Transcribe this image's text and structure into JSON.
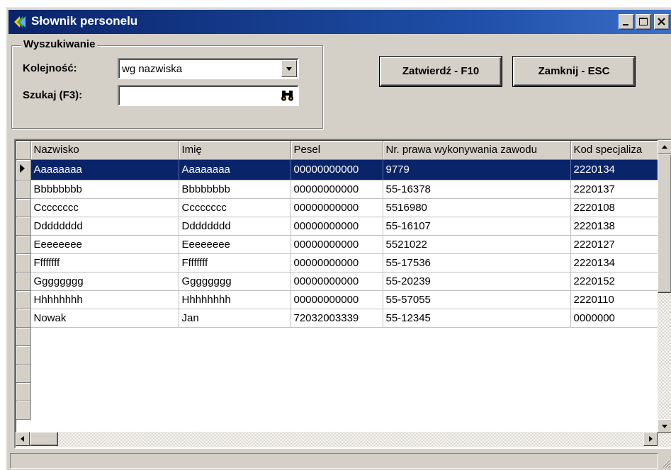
{
  "window": {
    "title": "Słownik personelu"
  },
  "search_group": {
    "legend": "Wyszukiwanie",
    "order_label": "Kolejność:",
    "order_value": "wg nazwiska",
    "search_label": "Szukaj (F3):",
    "search_value": ""
  },
  "buttons": {
    "confirm": "Zatwierdź - F10",
    "close": "Zamknij - ESC"
  },
  "grid": {
    "columns": [
      "Nazwisko",
      "Imię",
      "Pesel",
      "Nr. prawa wykonywania zawodu",
      "Kod specjaliza"
    ],
    "selected_row": 0,
    "rows": [
      [
        "Aaaaaaaa",
        "Aaaaaaaa",
        "00000000000",
        "9779",
        "2220134"
      ],
      [
        "Bbbbbbbb",
        "Bbbbbbbb",
        "00000000000",
        "55-16378",
        "2220137"
      ],
      [
        "Cccccccc",
        "Cccccccc",
        "00000000000",
        "5516980",
        "2220108"
      ],
      [
        "Dddddddd",
        "Dddddddd",
        "00000000000",
        "55-16107",
        "2220138"
      ],
      [
        "Eeeeeeee",
        "Eeeeeeee",
        "00000000000",
        "5521022",
        "2220127"
      ],
      [
        "Ffffffff",
        "Ffffffff",
        "00000000000",
        "55-17536",
        "2220134"
      ],
      [
        "Gggggggg",
        "Gggggggg",
        "00000000000",
        "55-20239",
        "2220152"
      ],
      [
        "Hhhhhhhh",
        "Hhhhhhhh",
        "00000000000",
        "55-57055",
        "2220110"
      ],
      [
        "Nowak",
        "Jan",
        "72032003339",
        "55-12345",
        "0000000"
      ]
    ]
  },
  "colors": {
    "titlebar": "#0a246a",
    "selection": "#0a246a",
    "face": "#d4d0c8"
  },
  "icons": [
    "app-icon",
    "minimize-icon",
    "maximize-icon",
    "close-icon",
    "dropdown-arrow-icon",
    "binoculars-icon",
    "row-pointer-icon",
    "scroll-up-icon",
    "scroll-down-icon",
    "scroll-left-icon",
    "scroll-right-icon",
    "resize-grip-icon"
  ]
}
